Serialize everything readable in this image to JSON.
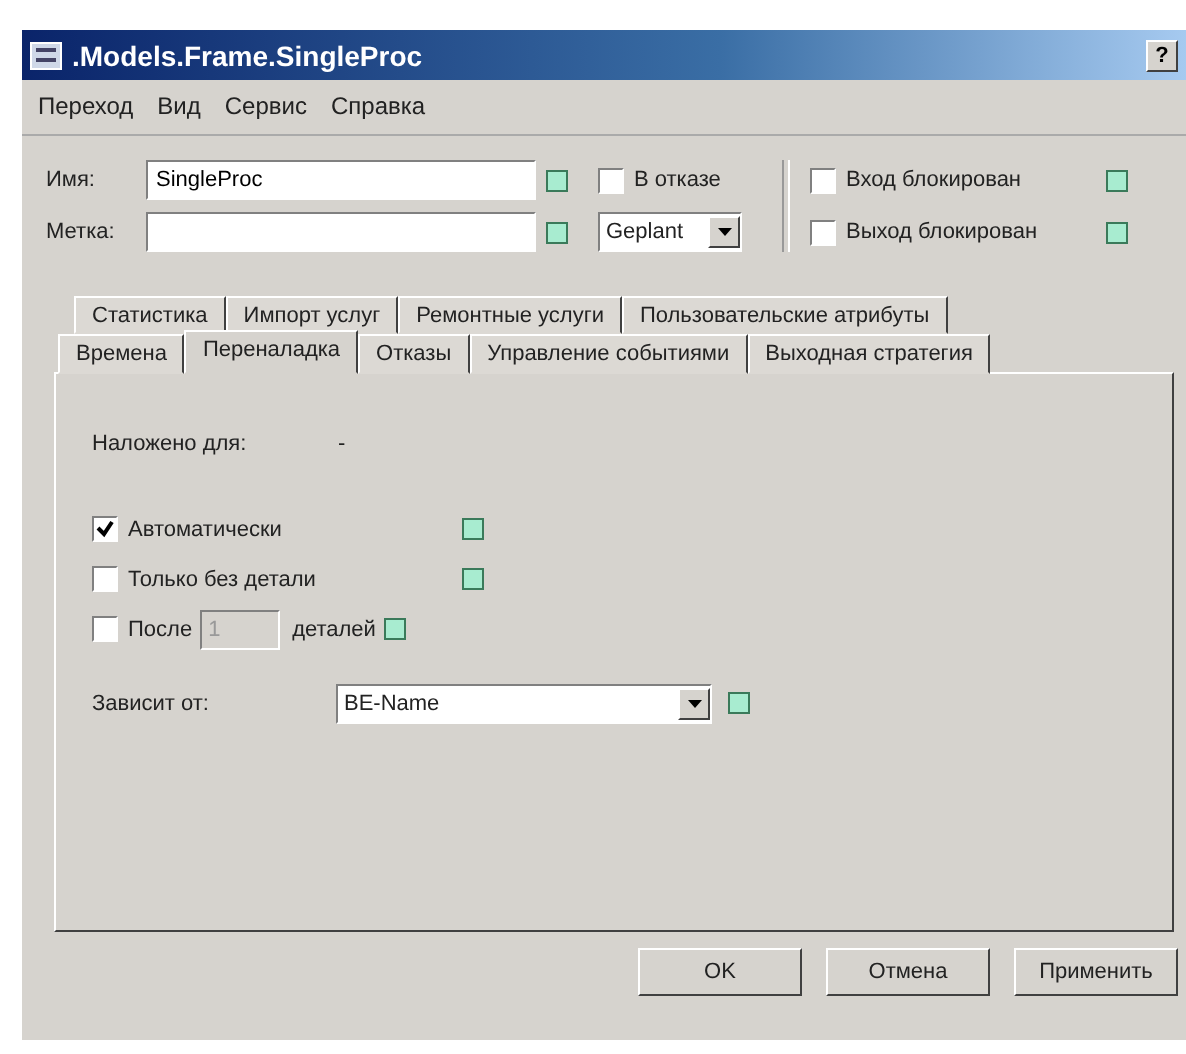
{
  "window": {
    "title": ".Models.Frame.SingleProc",
    "help": "?"
  },
  "menu": [
    "Переход",
    "Вид",
    "Сервис",
    "Справка"
  ],
  "name_field": {
    "label": "Имя:",
    "value": "SingleProc"
  },
  "tag_field": {
    "label": "Метка:"
  },
  "failed": {
    "label": "В отказе",
    "checked": false
  },
  "plan_select": {
    "value": "Geplant"
  },
  "entry_blocked": {
    "label": "Вход блокирован",
    "checked": false
  },
  "exit_blocked": {
    "label": "Выход блокирован",
    "checked": false
  },
  "tab_rows": [
    [
      {
        "label": "Статистика",
        "selected": false
      },
      {
        "label": "Импорт услуг",
        "selected": false
      },
      {
        "label": "Ремонтные услуги",
        "selected": false
      },
      {
        "label": "Пользовательские атрибуты",
        "selected": false
      }
    ],
    [
      {
        "label": "Времена",
        "selected": false
      },
      {
        "label": "Переналадка",
        "selected": true
      },
      {
        "label": "Отказы",
        "selected": false
      },
      {
        "label": "Управление событиями",
        "selected": false
      },
      {
        "label": "Выходная стратегия",
        "selected": false
      }
    ]
  ],
  "panel": {
    "setup_for": {
      "label": "Наложено для:",
      "value": "-"
    },
    "options": [
      {
        "kind": "plain",
        "label": "Автоматически",
        "checked": true
      },
      {
        "kind": "plain",
        "label": "Только без детали",
        "checked": false
      },
      {
        "kind": "count",
        "label": "После",
        "count": "1",
        "suffix": "деталей",
        "checked": false
      }
    ],
    "depends_on": {
      "label": "Зависит от:",
      "value": "BE-Name"
    }
  },
  "buttons": [
    "OK",
    "Отмена",
    "Применить"
  ]
}
